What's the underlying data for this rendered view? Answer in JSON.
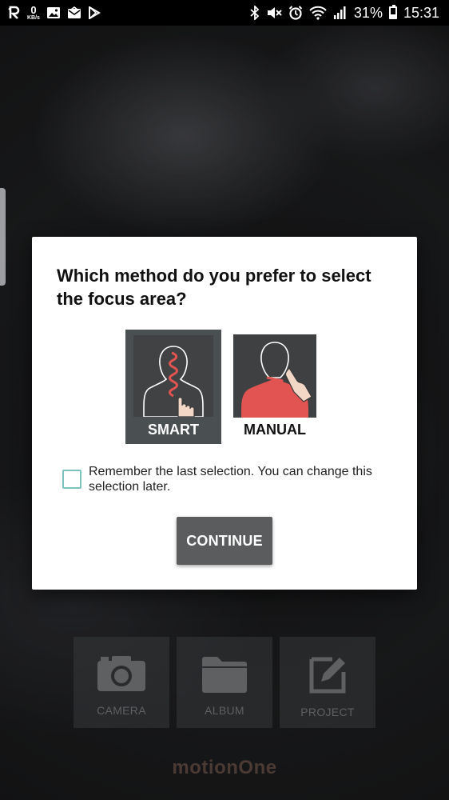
{
  "status_bar": {
    "net_speed_value": "0",
    "net_speed_unit": "KB/s",
    "battery_percent": "31%",
    "battery_level": 0.31,
    "time": "15:31",
    "left_icons": [
      "r-app-icon",
      "network-speed-indicator",
      "image-icon",
      "mail-icon",
      "play-store-icon"
    ],
    "right_icons": [
      "bluetooth-icon",
      "mute-icon",
      "alarm-icon",
      "wifi-icon",
      "signal-icon",
      "battery-icon"
    ]
  },
  "dialog": {
    "title": "Which method do you prefer to select the focus area?",
    "options": [
      {
        "label": "SMART",
        "selected": true,
        "icon": "smart-focus-icon"
      },
      {
        "label": "MANUAL",
        "selected": false,
        "icon": "manual-focus-icon"
      }
    ],
    "remember_text": "Remember the last selection. You can change this selection later.",
    "remember_checked": false,
    "continue_label": "CONTINUE"
  },
  "toolbar": {
    "items": [
      {
        "label": "CAMERA",
        "icon": "camera-icon"
      },
      {
        "label": "ALBUM",
        "icon": "folder-icon"
      },
      {
        "label": "PROJECT",
        "icon": "edit-icon"
      }
    ]
  },
  "brand": "motionOne",
  "colors": {
    "accent_checkbox": "#7ec2c0",
    "smart_selected_bg": "#4a5052",
    "continue_button_bg": "#5a5c5e",
    "manual_highlight": "#e25451"
  }
}
